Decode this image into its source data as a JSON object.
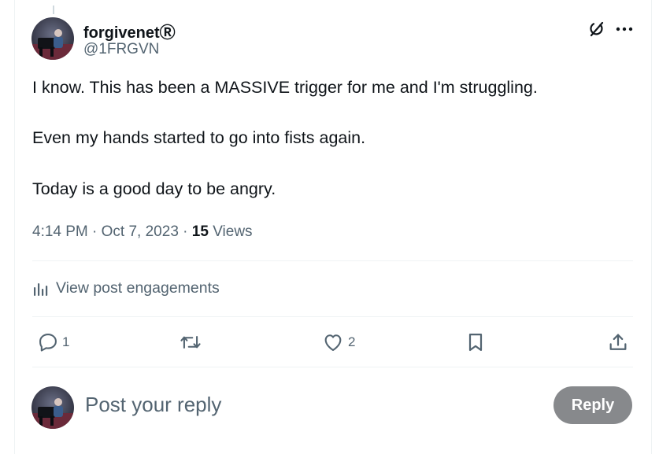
{
  "post": {
    "author_name": "forgivenetⓇ",
    "author_handle": "@1FRGVN",
    "lines": [
      "I know. This has been a MASSIVE trigger for me and I'm struggling.",
      "Even my hands started to go into fists again.",
      "Today is a good day to be angry."
    ],
    "time": "4:14 PM",
    "date": "Oct 7, 2023",
    "views_count": "15",
    "views_label": "Views",
    "engagements_label": "View post engagements"
  },
  "actions": {
    "reply_count": "1",
    "repost_count": "",
    "like_count": "2"
  },
  "reply_box": {
    "placeholder": "Post your reply",
    "button_label": "Reply"
  },
  "icons": {
    "top": [
      "grok-icon",
      "more-icon"
    ],
    "actions": [
      "reply-icon",
      "repost-icon",
      "like-icon",
      "bookmark-icon",
      "share-icon"
    ],
    "engagements": "bar-chart-icon"
  },
  "colors": {
    "text_primary": "#0f1419",
    "text_secondary": "#536471",
    "divider": "#eff3f4",
    "reply_button_bg": "#87898c"
  }
}
